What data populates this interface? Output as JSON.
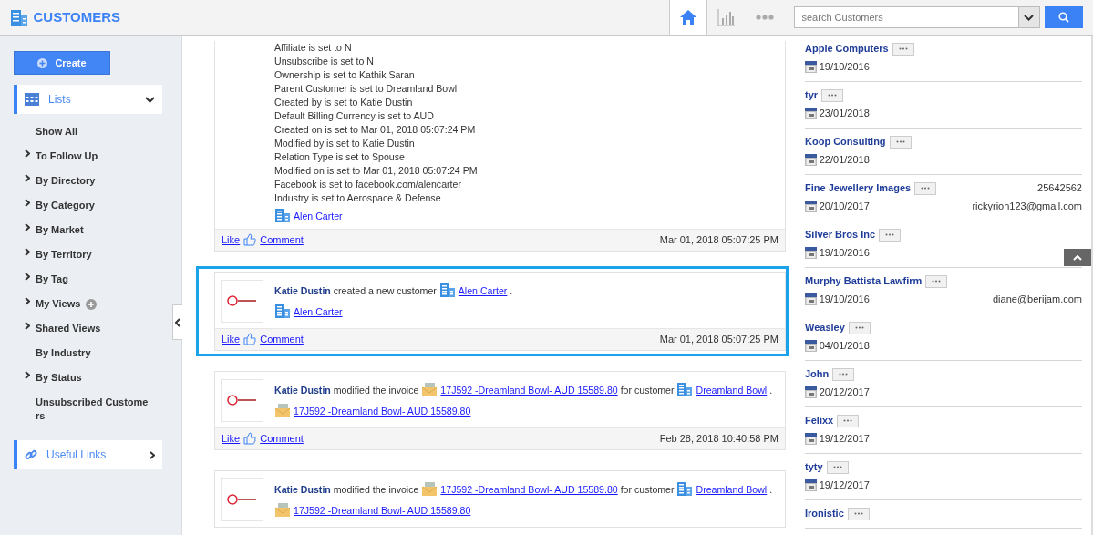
{
  "header": {
    "title": "CUSTOMERS",
    "nav": [
      {
        "kind": "home",
        "selected": true
      },
      {
        "kind": "chart",
        "selected": false
      },
      {
        "kind": "more",
        "selected": false
      }
    ],
    "search": {
      "placeholder": "search Customers"
    }
  },
  "sidebar": {
    "create": "Create",
    "sections": [
      {
        "kind": "lists",
        "label": "Lists",
        "expanded": true,
        "items": [
          {
            "label": "Show All",
            "has_children": false
          },
          {
            "label": "To Follow Up",
            "has_children": true
          },
          {
            "label": "By Directory",
            "has_children": true
          },
          {
            "label": "By Category",
            "has_children": true
          },
          {
            "label": "By Market",
            "has_children": true
          },
          {
            "label": "By Territory",
            "has_children": true
          },
          {
            "label": "By Tag",
            "has_children": true
          },
          {
            "label": "My Views",
            "has_children": true,
            "addable": true
          },
          {
            "label": "Shared Views",
            "has_children": true
          },
          {
            "label": "By Industry",
            "has_children": false
          },
          {
            "label": "By Status",
            "has_children": true
          },
          {
            "label": "Unsubscribed Custome rs",
            "has_children": false
          }
        ]
      },
      {
        "kind": "links",
        "label": "Useful Links",
        "expanded": false
      }
    ]
  },
  "feed": [
    {
      "highlighted": false,
      "lines": [
        "Affiliate is set to N",
        "Unsubscribe is set to N",
        "Ownership is set to Kathik Saran",
        "Parent Customer is set to Dreamland Bowl",
        "Created by is set to Katie Dustin",
        "Default Billing Currency is set to AUD",
        "Created on is set to Mar 01, 2018 05:07:24 PM",
        "Modified by is set to Katie Dustin",
        "Relation Type is set to Spouse",
        "Modified on is set to Mar 01, 2018 05:07:24 PM",
        "Facebook is set to facebook.com/alencarter",
        "Industry is set to Aerospace & Defense"
      ],
      "attachment": {
        "kind": "customer",
        "text": "Alen Carter"
      },
      "footer": {
        "like": "Like",
        "comment": "Comment",
        "time": "Mar 01, 2018 05:07:25 PM"
      }
    },
    {
      "highlighted": true,
      "actor": "Katie Dustin",
      "segments": [
        {
          "kind": "text",
          "text": "created a new customer"
        },
        {
          "kind": "customer",
          "text": "Alen Carter"
        },
        {
          "kind": "text",
          "text": "."
        }
      ],
      "attachment": {
        "kind": "customer",
        "text": "Alen Carter"
      },
      "footer": {
        "like": "Like",
        "comment": "Comment",
        "time": "Mar 01, 2018 05:07:25 PM"
      }
    },
    {
      "highlighted": false,
      "actor": "Katie Dustin",
      "segments": [
        {
          "kind": "text",
          "text": "modified the invoice"
        },
        {
          "kind": "invoice",
          "text": "17J592 -Dreamland Bowl- AUD 15589.80"
        },
        {
          "kind": "text",
          "text": "for customer"
        },
        {
          "kind": "customer",
          "text": "Dreamland Bowl"
        },
        {
          "kind": "text",
          "text": "."
        }
      ],
      "attachment": {
        "kind": "invoice",
        "text": "17J592 -Dreamland Bowl- AUD 15589.80"
      },
      "footer": {
        "like": "Like",
        "comment": "Comment",
        "time": "Feb 28, 2018 10:40:58 PM"
      }
    },
    {
      "highlighted": false,
      "actor": "Katie Dustin",
      "segments": [
        {
          "kind": "text",
          "text": "modified the invoice"
        },
        {
          "kind": "invoice",
          "text": "17J592 -Dreamland Bowl- AUD 15589.80"
        },
        {
          "kind": "text",
          "text": "for customer"
        },
        {
          "kind": "customer",
          "text": "Dreamland Bowl"
        },
        {
          "kind": "text",
          "text": "."
        }
      ],
      "attachment": {
        "kind": "invoice",
        "text": "17J592 -Dreamland Bowl- AUD 15589.80"
      }
    }
  ],
  "customers": [
    {
      "name": "Apple Computers",
      "date": "19/10/2016"
    },
    {
      "name": "tyr",
      "date": "23/01/2018"
    },
    {
      "name": "Koop Consulting",
      "date": "22/01/2018"
    },
    {
      "name": "Fine Jewellery Images",
      "date": "20/10/2017",
      "phone": "25642562",
      "email": "rickyrion123@gmail.com"
    },
    {
      "name": "Silver Bros Inc",
      "date": "19/10/2016"
    },
    {
      "name": "Murphy Battista Lawfirm",
      "date": "19/10/2016",
      "email": "diane@berijam.com"
    },
    {
      "name": "Weasley",
      "date": "04/01/2018"
    },
    {
      "name": "John",
      "date": "20/12/2017"
    },
    {
      "name": "Felixx",
      "date": "19/12/2017"
    },
    {
      "name": "tyty",
      "date": "19/12/2017"
    },
    {
      "name": "Ironistic"
    }
  ]
}
